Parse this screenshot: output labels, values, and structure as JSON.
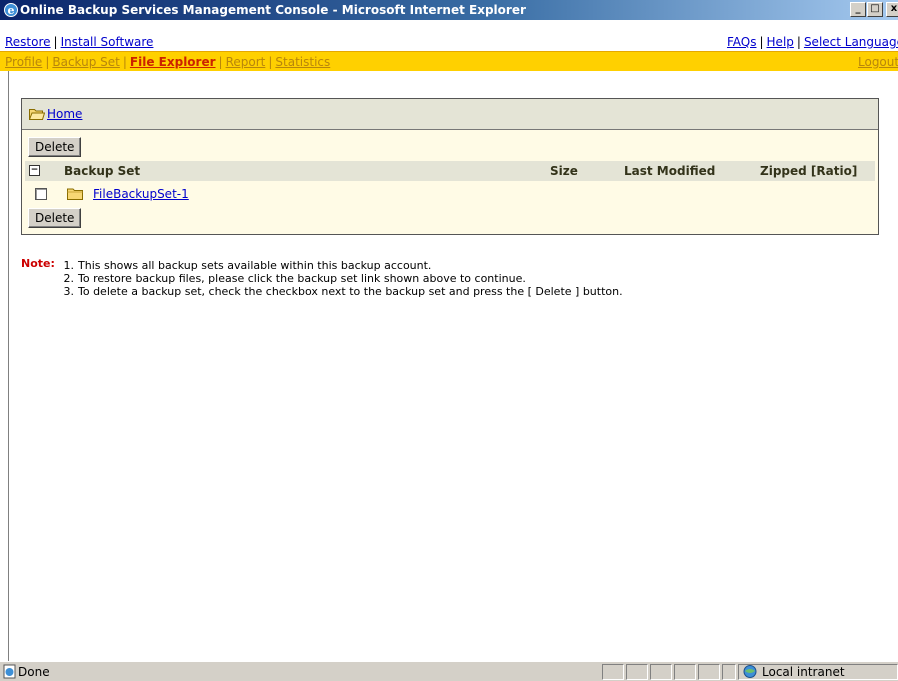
{
  "window": {
    "title": "Online Backup Services Management Console - Microsoft Internet Explorer",
    "minimize": "_",
    "maximize": "□",
    "close": "x"
  },
  "toplinks": {
    "left": [
      "Restore",
      "Install Software"
    ],
    "right": [
      "FAQs",
      "Help",
      "Select Language"
    ],
    "separator": "|"
  },
  "nav": {
    "items": [
      "Profile",
      "Backup Set",
      "File Explorer",
      "Report",
      "Statistics"
    ],
    "active": "File Explorer",
    "logout": "Logout"
  },
  "panel": {
    "breadcrumb": "Home",
    "delete_label": "Delete",
    "columns": {
      "name": "Backup Set",
      "size": "Size",
      "modified": "Last Modified",
      "zipped": "Zipped [Ratio]"
    },
    "rows": [
      {
        "name": "FileBackupSet-1",
        "size": "",
        "modified": "",
        "zipped": "",
        "checked": false
      }
    ]
  },
  "note": {
    "label": "Note:",
    "items": [
      {
        "num": "1.",
        "text": "This shows all backup sets available within this backup account."
      },
      {
        "num": "2.",
        "text": "To restore backup files, please click the backup set link shown above to continue."
      },
      {
        "num": "3.",
        "text": "To delete a backup set, check the checkbox next to the backup set and press the [ Delete ] button."
      }
    ]
  },
  "statusbar": {
    "status": "Done",
    "zone": "Local intranet"
  },
  "colors": {
    "navbar": "#ffd000",
    "nav_link": "#b8860b",
    "nav_active": "#cc2200",
    "link": "#0000cc",
    "note_label": "#cc0000",
    "panel_bg": "#fffbe6"
  }
}
